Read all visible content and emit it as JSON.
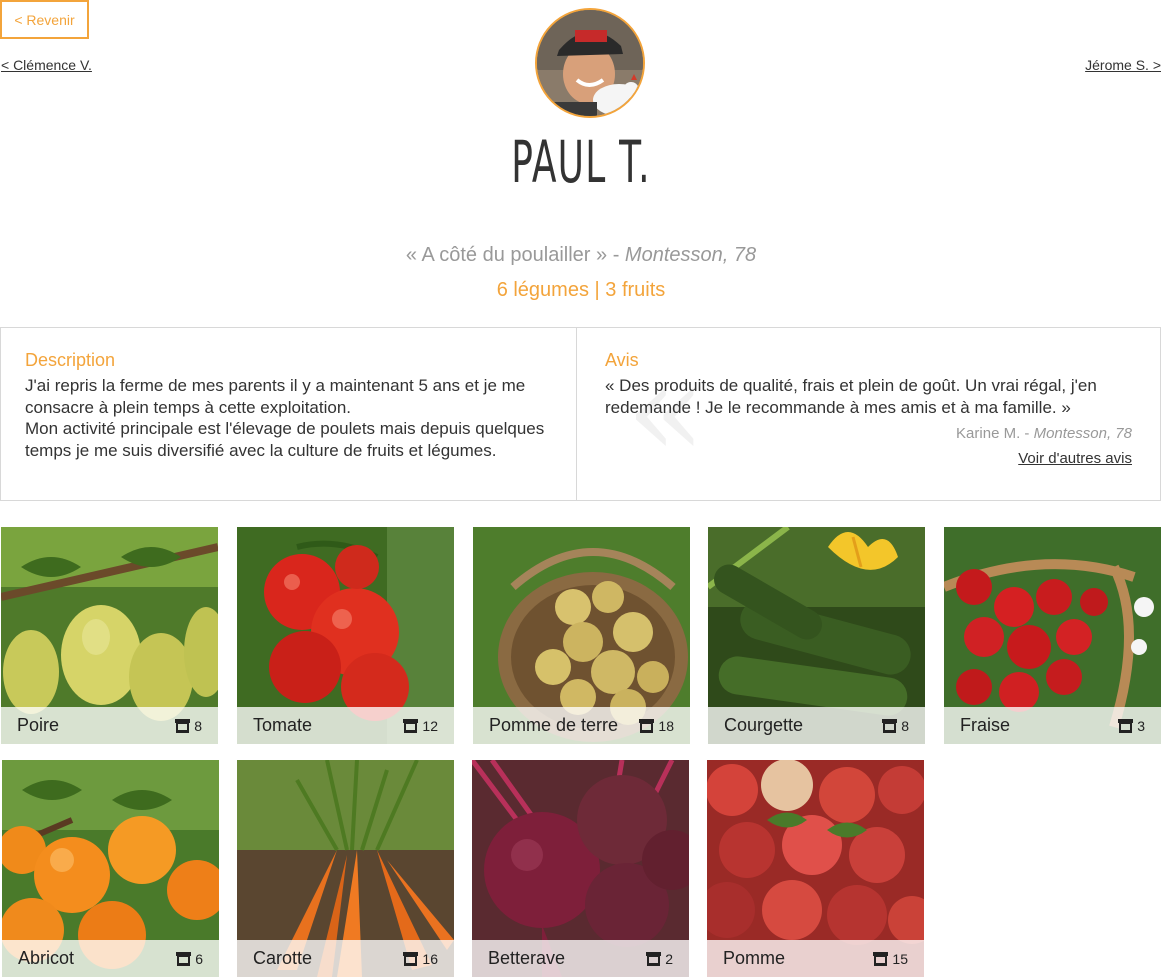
{
  "nav": {
    "back_label": "< Revenir",
    "prev_label": "< Clémence V.",
    "next_label": "Jérome S. >"
  },
  "producer": {
    "name": "PAUL T.",
    "farm": "« A côté du poulailler »",
    "separator": " - ",
    "location": "Montesson, 78",
    "counts": "6 légumes | 3 fruits"
  },
  "description": {
    "title": "Description",
    "paragraphs": [
      "J'ai repris la ferme de mes parents il y a maintenant 5 ans et je me consacre à plein temps à cette exploitation.",
      "Mon activité principale est l'élevage de poulets mais depuis quelques temps je me suis diversifié avec la culture de fruits et légumes."
    ]
  },
  "review": {
    "title": "Avis",
    "quote_mark": "«",
    "text": "« Des produits de qualité, frais et plein de goût. Un vrai régal, j'en redemande ! Je le recommande à mes amis et à ma famille. »",
    "author": "Karine M.",
    "author_sep": " - ",
    "author_location": "Montesson, 78",
    "more_label": "Voir d'autres avis"
  },
  "products": [
    {
      "label": "Poire",
      "count": "8",
      "icon": "stall-icon"
    },
    {
      "label": "Tomate",
      "count": "12",
      "icon": "stall-icon"
    },
    {
      "label": "Pomme de terre",
      "count": "18",
      "icon": "stall-icon"
    },
    {
      "label": "Courgette",
      "count": "8",
      "icon": "stall-icon"
    },
    {
      "label": "Fraise",
      "count": "3",
      "icon": "stall-icon"
    },
    {
      "label": "Abricot",
      "count": "6",
      "icon": "stall-icon"
    },
    {
      "label": "Carotte",
      "count": "16",
      "icon": "stall-icon"
    },
    {
      "label": "Betterave",
      "count": "2",
      "icon": "stall-icon"
    },
    {
      "label": "Pomme",
      "count": "15",
      "icon": "stall-icon"
    }
  ],
  "colors": {
    "accent": "#f3a43b",
    "muted_text": "#999999",
    "border": "#d8d8d8"
  }
}
